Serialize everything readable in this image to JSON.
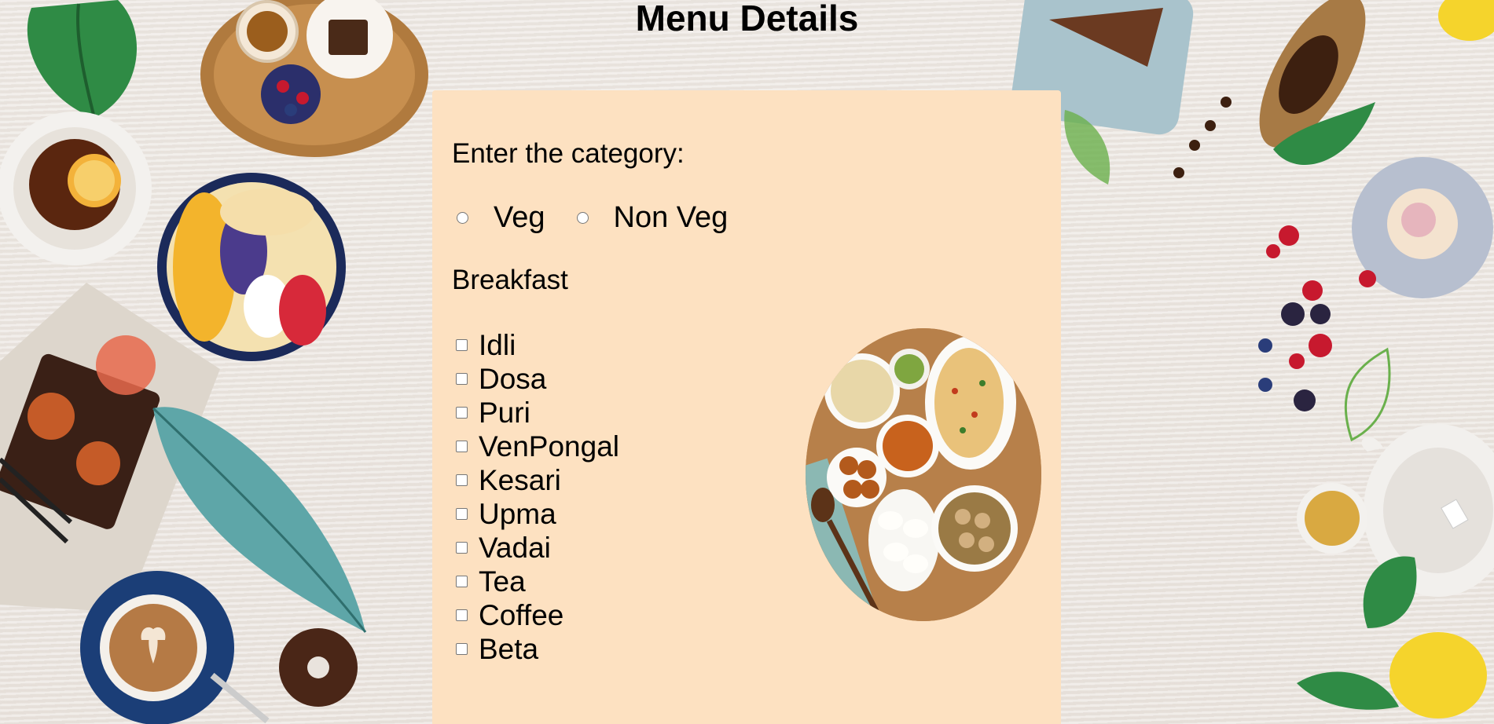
{
  "page": {
    "title": "Menu Details"
  },
  "form": {
    "category_label": "Enter the category:",
    "category_options": [
      {
        "label": "Veg",
        "selected": false
      },
      {
        "label": "Non Veg",
        "selected": false
      }
    ],
    "section_heading": "Breakfast",
    "items": [
      {
        "label": "Idli",
        "checked": false
      },
      {
        "label": "Dosa",
        "checked": false
      },
      {
        "label": "Puri",
        "checked": false
      },
      {
        "label": "VenPongal",
        "checked": false
      },
      {
        "label": "Kesari",
        "checked": false
      },
      {
        "label": "Upma",
        "checked": false
      },
      {
        "label": "Vadai",
        "checked": false
      },
      {
        "label": "Tea",
        "checked": false
      },
      {
        "label": "Coffee",
        "checked": false
      },
      {
        "label": "Beta",
        "checked": false
      }
    ]
  },
  "colors": {
    "card_background": "#fde1c1",
    "page_background": "#ece7e2"
  },
  "icons": {
    "radio": "radio-circle",
    "checkbox": "checkbox-square",
    "food_image": "south-indian-breakfast-platter"
  }
}
